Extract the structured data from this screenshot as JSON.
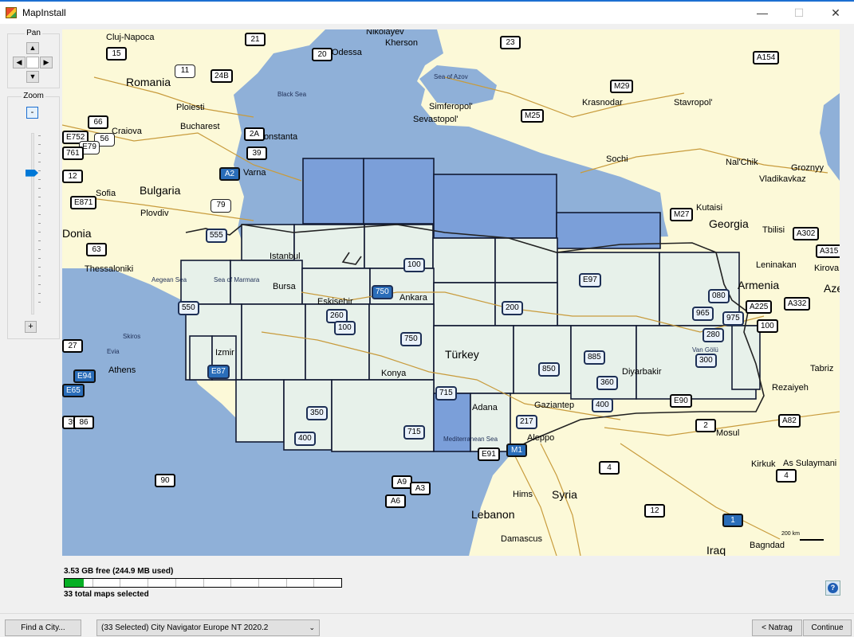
{
  "window": {
    "title": "MapInstall",
    "minimize": "—",
    "maximize": "☐",
    "close": "✕"
  },
  "pan": {
    "label": "Pan",
    "up": "▲",
    "left": "◀",
    "right": "▶",
    "down": "▼"
  },
  "zoom": {
    "label": "Zoom",
    "minus": "-",
    "plus": "+",
    "level_fraction": 0.2
  },
  "map": {
    "places": [
      "Cluj-Napoca",
      "Nikolayev",
      "Kherson",
      "Odessa",
      "Romania",
      "Sea of Azov",
      "Black Sea",
      "Ploiesti",
      "Bucharest",
      "Craiova",
      "Constanta",
      "Simferopol'",
      "Sevastopol'",
      "Krasnodar",
      "Stavropol'",
      "Varna",
      "Bulgaria",
      "Sofia",
      "Plovdiv",
      "Sochi",
      "Nal'Chik",
      "Groznyy",
      "Vladikavkaz",
      "Kutaisi",
      "Georgia",
      "Tbilisi",
      "Istanbul",
      "Aegean Sea",
      "Sea of Marmara",
      "Bursa",
      "Thessaloniki",
      "Leninakan",
      "Kirova",
      "Armenia",
      "Aze",
      "Eskisehir",
      "Ankara",
      "Skiros",
      "Izmir",
      "Evia",
      "Athens",
      "Türkey",
      "Konya",
      "Diyarbakir",
      "Tabriz",
      "Rezaiyeh",
      "Adana",
      "Gaziantep",
      "Mosul",
      "Mediterranean Sea",
      "Aleppo",
      "Kirkuk",
      "As Sulaymani",
      "Syria",
      "Hims",
      "Lebanon",
      "Damascus",
      "Iraq",
      "Bagndad",
      "Donia",
      "Van Gölü"
    ],
    "route_shields": [
      "21",
      "23",
      "15",
      "20",
      "A154",
      "11",
      "24B",
      "M29",
      "66",
      "56",
      "M25",
      "E752",
      "E79",
      "761",
      "2A",
      "39",
      "A2",
      "12",
      "E871",
      "79",
      "M27",
      "A302",
      "A315",
      "63",
      "555",
      "100",
      "750",
      "E97",
      "080",
      "A225",
      "A332",
      "550",
      "200",
      "260",
      "100",
      "965",
      "975",
      "100",
      "27",
      "E94",
      "E65",
      "E87",
      "750",
      "280",
      "300",
      "885",
      "850",
      "360",
      "715",
      "400",
      "E90",
      "39",
      "86",
      "350",
      "217",
      "715",
      "400",
      "2",
      "A82",
      "E91",
      "M1",
      "4",
      "90",
      "A9",
      "A3",
      "A6",
      "12",
      "1",
      "4"
    ],
    "scale_label": "200 km"
  },
  "storage": {
    "free_text": "3.53 GB free (244.9 MB used)",
    "used_fraction": 0.07,
    "maps_selected_text": "33 total maps selected"
  },
  "help_icon": "?",
  "footer": {
    "find_city": "Find a City...",
    "map_product": "(33 Selected) City Navigator Europe NT 2020.2",
    "back": "< Natrag",
    "continue": "Continue"
  },
  "colors": {
    "land": "#fcf9d8",
    "sea": "#8fb0d8",
    "selected_tile": "#e7f1ea",
    "selected_sea_tile": "#7b9fd9",
    "road": "#c89b3c",
    "highway_blue": "#2a6db9",
    "progress": "#06b025",
    "accent": "#0078d7"
  }
}
